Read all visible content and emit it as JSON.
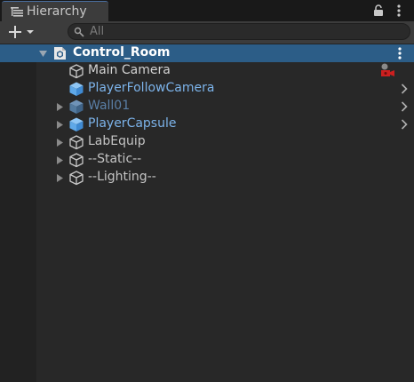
{
  "window": {
    "tab_label": "Hierarchy",
    "tab_icon": "hierarchy-list-icon",
    "lock_icon": "lock-icon",
    "menu_icon": "kebab-menu-icon"
  },
  "toolbar": {
    "add_icon": "plus-dropdown-icon",
    "search_placeholder": "All",
    "search_icon": "search-icon"
  },
  "colors": {
    "selection": "#2c5d87",
    "prefab_text": "#7cb3ea",
    "prefab_icon": "#5fa8e8",
    "panel_bg": "#282828"
  },
  "tree": {
    "scene": {
      "label": "Control_Room",
      "expanded": true,
      "selected": true,
      "icon": "unity-scene-icon"
    },
    "items": [
      {
        "label": "Main Camera",
        "type": "gameobject",
        "icon": "cube-outline-icon",
        "foldout": false,
        "status_icon": "camera-warning-icon"
      },
      {
        "label": "PlayerFollowCamera",
        "type": "prefab",
        "icon": "prefab-cube-icon",
        "foldout": false,
        "chevron": true
      },
      {
        "label": "Wall01",
        "type": "prefab-disabled",
        "icon": "prefab-cube-icon",
        "foldout": true,
        "chevron": true
      },
      {
        "label": "PlayerCapsule",
        "type": "prefab",
        "icon": "prefab-cube-icon",
        "foldout": true,
        "chevron": true
      },
      {
        "label": "LabEquip",
        "type": "gameobject",
        "icon": "cube-outline-icon",
        "foldout": true
      },
      {
        "label": "--Static--",
        "type": "gameobject",
        "icon": "cube-outline-icon",
        "foldout": true
      },
      {
        "label": "--Lighting--",
        "type": "gameobject",
        "icon": "cube-outline-icon",
        "foldout": true
      }
    ]
  }
}
